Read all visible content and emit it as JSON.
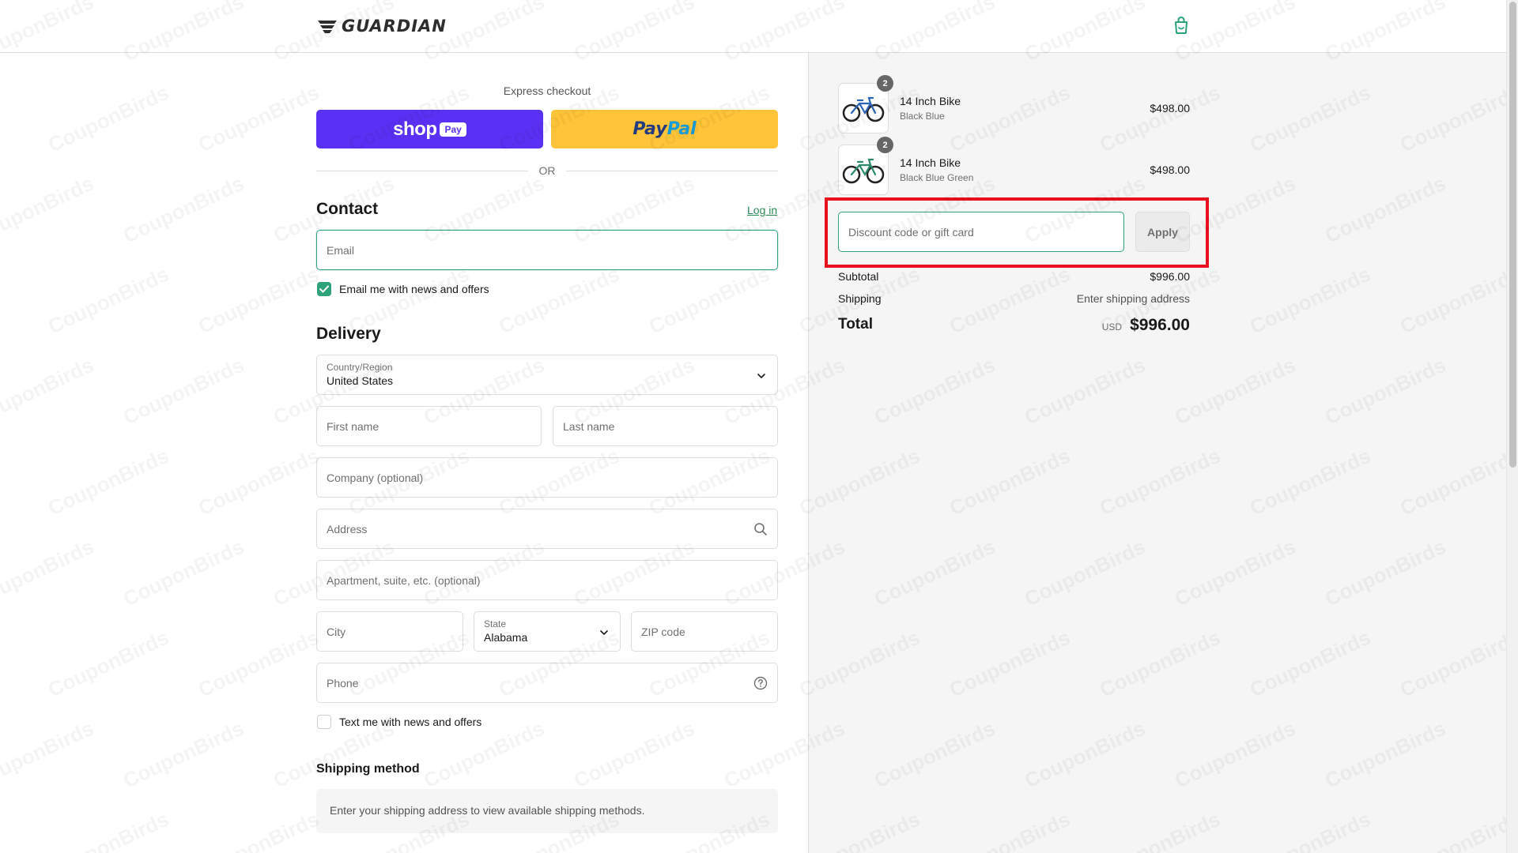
{
  "header": {
    "logo_text": "GUARDIAN",
    "cart_icon": "shopping-bag-icon"
  },
  "express": {
    "title": "Express checkout",
    "shoppay_word": "shop",
    "shoppay_pill": "Pay",
    "paypal_pay": "Pay",
    "paypal_pal": "Pal",
    "or_text": "OR"
  },
  "contact": {
    "heading": "Contact",
    "login_label": "Log in",
    "email_placeholder": "Email",
    "news_checkbox_label": "Email me with news and offers",
    "news_checked": true
  },
  "delivery": {
    "heading": "Delivery",
    "country_label": "Country/Region",
    "country_value": "United States",
    "first_name_placeholder": "First name",
    "last_name_placeholder": "Last name",
    "company_placeholder": "Company (optional)",
    "address_placeholder": "Address",
    "apartment_placeholder": "Apartment, suite, etc. (optional)",
    "city_placeholder": "City",
    "state_label": "State",
    "state_value": "Alabama",
    "zip_placeholder": "ZIP code",
    "phone_placeholder": "Phone",
    "text_checkbox_label": "Text me with news and offers",
    "text_checked": false
  },
  "shipping_method": {
    "heading": "Shipping method",
    "message": "Enter your shipping address to view available shipping methods."
  },
  "order": {
    "items": [
      {
        "name": "14 Inch Bike",
        "variant": "Black Blue",
        "price": "$498.00",
        "quantity": "2"
      },
      {
        "name": "14 Inch Bike",
        "variant": "Black Blue Green",
        "price": "$498.00",
        "quantity": "2"
      }
    ],
    "discount_placeholder": "Discount code or gift card",
    "apply_label": "Apply",
    "subtotal_label": "Subtotal",
    "subtotal_value": "$996.00",
    "shipping_label": "Shipping",
    "shipping_value": "Enter shipping address",
    "total_label": "Total",
    "currency": "USD",
    "total_value": "$996.00"
  },
  "watermark": "CouponBirds",
  "colors": {
    "accent": "#2ea37a",
    "shoppay": "#5a31f4",
    "paypal": "#ffc439",
    "highlight": "#e8101c"
  }
}
